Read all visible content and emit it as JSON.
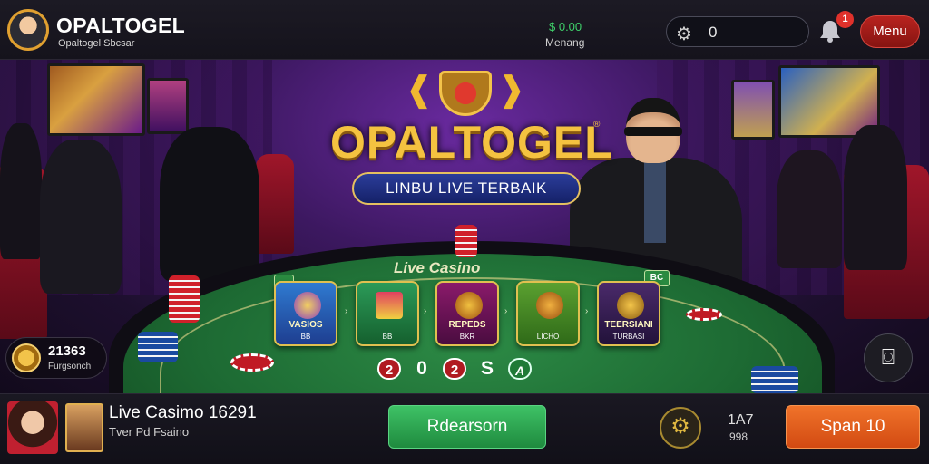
{
  "header": {
    "brand_title": "OPALTOGEL",
    "brand_subtitle": "Opaltogel Sbcsar",
    "balance_amount": "$ 0.00",
    "balance_label": "Menang",
    "search_value": "0",
    "notification_count": "1",
    "menu_label": "Menu"
  },
  "stage": {
    "logo_text": "OPALTOGEL",
    "logo_mark": "®",
    "banner_text": "LINBU LIVE TERBAIK",
    "felt_title": "Live Casino",
    "badge_left_top": "",
    "badge_right_top": "BC",
    "games": [
      {
        "title": "VASIOS",
        "sub": "BB"
      },
      {
        "title": "",
        "sub": "BB"
      },
      {
        "title": "REPEDS",
        "sub": "BKR"
      },
      {
        "title": "",
        "sub": "LICHO"
      },
      {
        "title": "TEERSIANI",
        "sub": "TURBASI"
      }
    ],
    "counters": [
      "2",
      "0",
      "2",
      "S",
      "A"
    ],
    "left_badge_value": "21363",
    "left_badge_label": "Furgsonch"
  },
  "footer": {
    "title": "Live Casimo 16291",
    "subtitle": "Tver Pd Fsaino",
    "primary_button": "Rdearsorn",
    "stat_top": "1A7",
    "stat_bottom": "998",
    "spin_button": "Span 10"
  },
  "colors": {
    "brand_gold": "#f4c240",
    "felt_green": "#1d6a33",
    "primary_green": "#3ec266",
    "spin_orange": "#f0732a",
    "menu_red": "#b8231f"
  },
  "icons": {
    "search": "gear-icon",
    "notification": "bell-icon",
    "fab": "chat-icon",
    "settings": "settings-icon"
  }
}
